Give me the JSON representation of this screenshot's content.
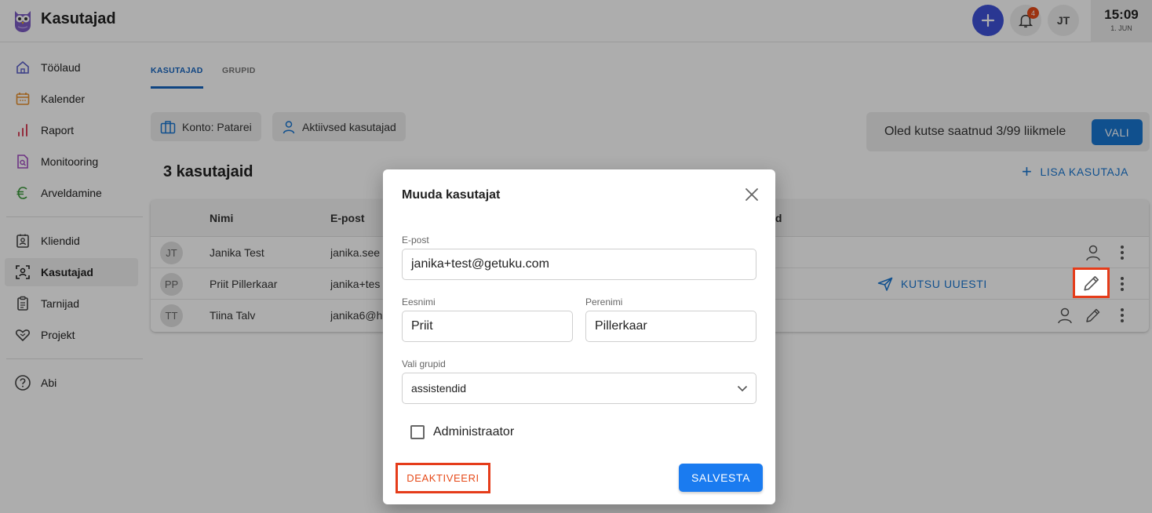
{
  "header": {
    "app_title": "Kasutajad",
    "notification_count": "4",
    "user_initials": "JT",
    "clock_time": "15:09",
    "clock_date": "1. JUN"
  },
  "sidebar": {
    "items": [
      {
        "label": "Töölaud",
        "icon": "home-icon"
      },
      {
        "label": "Kalender",
        "icon": "calendar-icon"
      },
      {
        "label": "Raport",
        "icon": "bar-chart-icon"
      },
      {
        "label": "Monitooring",
        "icon": "document-search-icon"
      },
      {
        "label": "Arveldamine",
        "icon": "euro-icon"
      },
      {
        "label": "Kliendid",
        "icon": "contact-card-icon"
      },
      {
        "label": "Kasutajad",
        "icon": "user-scan-icon"
      },
      {
        "label": "Tarnijad",
        "icon": "clipboard-icon"
      },
      {
        "label": "Projekt",
        "icon": "heart-handshake-icon"
      },
      {
        "label": "Abi",
        "icon": "help-icon"
      }
    ]
  },
  "tabs": {
    "users": "KASUTAJAD",
    "groups": "GRUPID"
  },
  "filters": {
    "account": "Konto: Patarei",
    "active_users": "Aktiivsed kasutajad"
  },
  "invite": {
    "text": "Oled kutse saatnud 3/99 liikmele",
    "button": "VALI"
  },
  "users_count": "3 kasutajaid",
  "add_user": "LISA KASUTAJA",
  "table": {
    "headers": {
      "name": "Nimi",
      "email": "E-post",
      "trailing": "id"
    },
    "rows": [
      {
        "initials": "JT",
        "name": "Janika Test",
        "email": "janika.see"
      },
      {
        "initials": "PP",
        "name": "Priit Pillerkaar",
        "email": "janika+tes",
        "action": "KUTSU UUESTI"
      },
      {
        "initials": "TT",
        "name": "Tiina Talv",
        "email": "janika6@h"
      }
    ]
  },
  "modal": {
    "title": "Muuda kasutajat",
    "email_label": "E-post",
    "email_value": "janika+test@getuku.com",
    "first_name_label": "Eesnimi",
    "first_name_value": "Priit",
    "last_name_label": "Perenimi",
    "last_name_value": "Pillerkaar",
    "groups_label": "Vali grupid",
    "groups_value": "assistendid",
    "admin_label": "Administraator",
    "admin_checked": false,
    "deactivate": "DEAKTIVEERI",
    "save": "SALVESTA"
  },
  "colors": {
    "primary": "#1976d2",
    "accent_purple": "#3f51d8",
    "danger": "#e64a19",
    "highlight": "#e53c1a"
  }
}
